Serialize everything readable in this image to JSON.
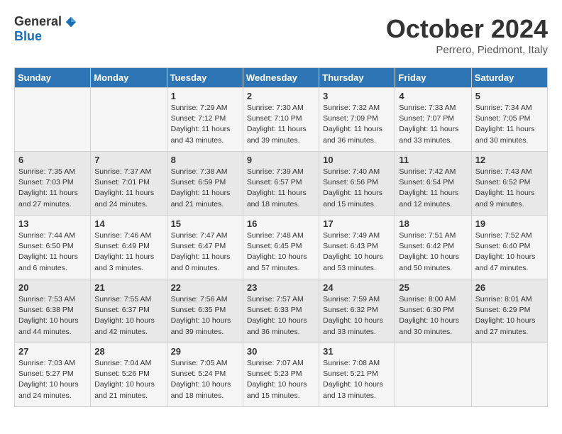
{
  "header": {
    "logo_general": "General",
    "logo_blue": "Blue",
    "month_title": "October 2024",
    "location": "Perrero, Piedmont, Italy"
  },
  "days_of_week": [
    "Sunday",
    "Monday",
    "Tuesday",
    "Wednesday",
    "Thursday",
    "Friday",
    "Saturday"
  ],
  "weeks": [
    [
      {
        "day": "",
        "info": ""
      },
      {
        "day": "",
        "info": ""
      },
      {
        "day": "1",
        "info": "Sunrise: 7:29 AM\nSunset: 7:12 PM\nDaylight: 11 hours\nand 43 minutes."
      },
      {
        "day": "2",
        "info": "Sunrise: 7:30 AM\nSunset: 7:10 PM\nDaylight: 11 hours\nand 39 minutes."
      },
      {
        "day": "3",
        "info": "Sunrise: 7:32 AM\nSunset: 7:09 PM\nDaylight: 11 hours\nand 36 minutes."
      },
      {
        "day": "4",
        "info": "Sunrise: 7:33 AM\nSunset: 7:07 PM\nDaylight: 11 hours\nand 33 minutes."
      },
      {
        "day": "5",
        "info": "Sunrise: 7:34 AM\nSunset: 7:05 PM\nDaylight: 11 hours\nand 30 minutes."
      }
    ],
    [
      {
        "day": "6",
        "info": "Sunrise: 7:35 AM\nSunset: 7:03 PM\nDaylight: 11 hours\nand 27 minutes."
      },
      {
        "day": "7",
        "info": "Sunrise: 7:37 AM\nSunset: 7:01 PM\nDaylight: 11 hours\nand 24 minutes."
      },
      {
        "day": "8",
        "info": "Sunrise: 7:38 AM\nSunset: 6:59 PM\nDaylight: 11 hours\nand 21 minutes."
      },
      {
        "day": "9",
        "info": "Sunrise: 7:39 AM\nSunset: 6:57 PM\nDaylight: 11 hours\nand 18 minutes."
      },
      {
        "day": "10",
        "info": "Sunrise: 7:40 AM\nSunset: 6:56 PM\nDaylight: 11 hours\nand 15 minutes."
      },
      {
        "day": "11",
        "info": "Sunrise: 7:42 AM\nSunset: 6:54 PM\nDaylight: 11 hours\nand 12 minutes."
      },
      {
        "day": "12",
        "info": "Sunrise: 7:43 AM\nSunset: 6:52 PM\nDaylight: 11 hours\nand 9 minutes."
      }
    ],
    [
      {
        "day": "13",
        "info": "Sunrise: 7:44 AM\nSunset: 6:50 PM\nDaylight: 11 hours\nand 6 minutes."
      },
      {
        "day": "14",
        "info": "Sunrise: 7:46 AM\nSunset: 6:49 PM\nDaylight: 11 hours\nand 3 minutes."
      },
      {
        "day": "15",
        "info": "Sunrise: 7:47 AM\nSunset: 6:47 PM\nDaylight: 11 hours\nand 0 minutes."
      },
      {
        "day": "16",
        "info": "Sunrise: 7:48 AM\nSunset: 6:45 PM\nDaylight: 10 hours\nand 57 minutes."
      },
      {
        "day": "17",
        "info": "Sunrise: 7:49 AM\nSunset: 6:43 PM\nDaylight: 10 hours\nand 53 minutes."
      },
      {
        "day": "18",
        "info": "Sunrise: 7:51 AM\nSunset: 6:42 PM\nDaylight: 10 hours\nand 50 minutes."
      },
      {
        "day": "19",
        "info": "Sunrise: 7:52 AM\nSunset: 6:40 PM\nDaylight: 10 hours\nand 47 minutes."
      }
    ],
    [
      {
        "day": "20",
        "info": "Sunrise: 7:53 AM\nSunset: 6:38 PM\nDaylight: 10 hours\nand 44 minutes."
      },
      {
        "day": "21",
        "info": "Sunrise: 7:55 AM\nSunset: 6:37 PM\nDaylight: 10 hours\nand 42 minutes."
      },
      {
        "day": "22",
        "info": "Sunrise: 7:56 AM\nSunset: 6:35 PM\nDaylight: 10 hours\nand 39 minutes."
      },
      {
        "day": "23",
        "info": "Sunrise: 7:57 AM\nSunset: 6:33 PM\nDaylight: 10 hours\nand 36 minutes."
      },
      {
        "day": "24",
        "info": "Sunrise: 7:59 AM\nSunset: 6:32 PM\nDaylight: 10 hours\nand 33 minutes."
      },
      {
        "day": "25",
        "info": "Sunrise: 8:00 AM\nSunset: 6:30 PM\nDaylight: 10 hours\nand 30 minutes."
      },
      {
        "day": "26",
        "info": "Sunrise: 8:01 AM\nSunset: 6:29 PM\nDaylight: 10 hours\nand 27 minutes."
      }
    ],
    [
      {
        "day": "27",
        "info": "Sunrise: 7:03 AM\nSunset: 5:27 PM\nDaylight: 10 hours\nand 24 minutes."
      },
      {
        "day": "28",
        "info": "Sunrise: 7:04 AM\nSunset: 5:26 PM\nDaylight: 10 hours\nand 21 minutes."
      },
      {
        "day": "29",
        "info": "Sunrise: 7:05 AM\nSunset: 5:24 PM\nDaylight: 10 hours\nand 18 minutes."
      },
      {
        "day": "30",
        "info": "Sunrise: 7:07 AM\nSunset: 5:23 PM\nDaylight: 10 hours\nand 15 minutes."
      },
      {
        "day": "31",
        "info": "Sunrise: 7:08 AM\nSunset: 5:21 PM\nDaylight: 10 hours\nand 13 minutes."
      },
      {
        "day": "",
        "info": ""
      },
      {
        "day": "",
        "info": ""
      }
    ]
  ]
}
